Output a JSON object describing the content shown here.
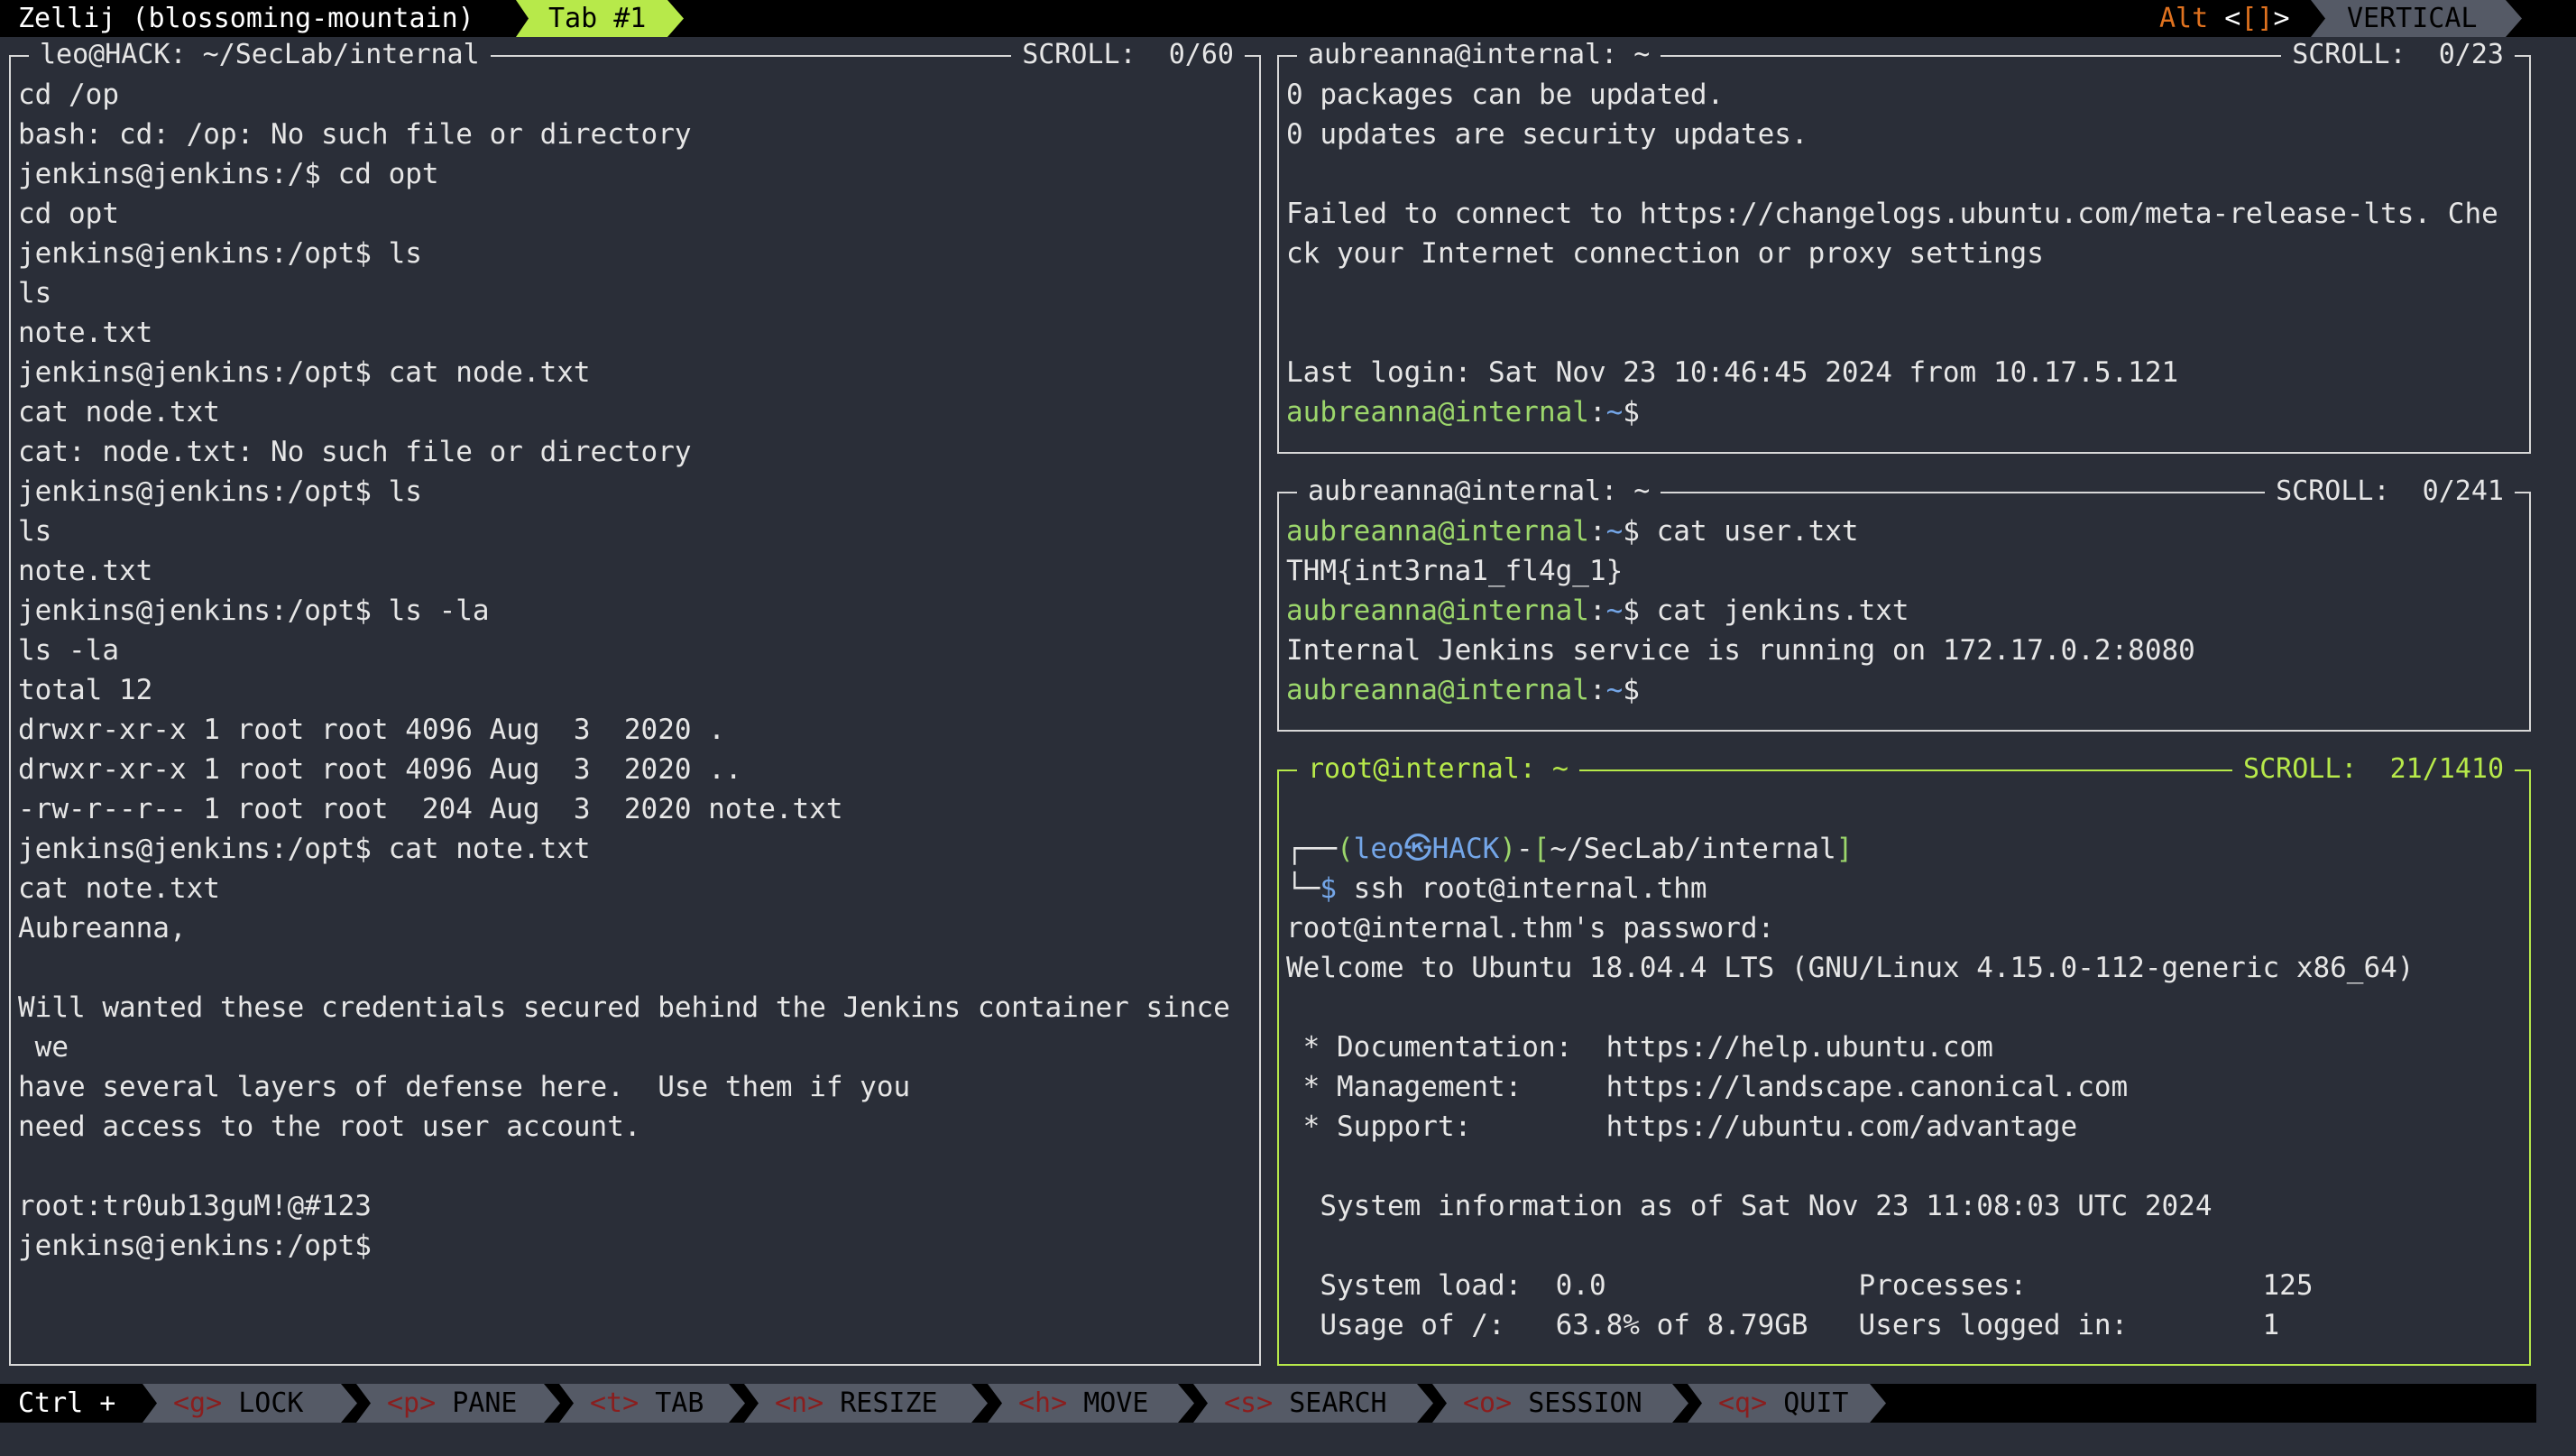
{
  "topbar": {
    "title": "Zellij (blossoming-mountain)",
    "tab_label": "Tab #1",
    "mode_alt_prefix": "Alt ",
    "mode_alt_lt": "<",
    "mode_alt_brackets": "[]",
    "mode_alt_gt": ">",
    "layout_label": "VERTICAL"
  },
  "left_pane": {
    "title": "leo@HACK: ~/SecLab/internal",
    "scroll": "SCROLL:  0/60",
    "lines": [
      "cd /op",
      "bash: cd: /op: No such file or directory",
      "jenkins@jenkins:/$ cd opt",
      "cd opt",
      "jenkins@jenkins:/opt$ ls",
      "ls",
      "note.txt",
      "jenkins@jenkins:/opt$ cat node.txt",
      "cat node.txt",
      "cat: node.txt: No such file or directory",
      "jenkins@jenkins:/opt$ ls",
      "ls",
      "note.txt",
      "jenkins@jenkins:/opt$ ls -la",
      "ls -la",
      "total 12",
      "drwxr-xr-x 1 root root 4096 Aug  3  2020 .",
      "drwxr-xr-x 1 root root 4096 Aug  3  2020 ..",
      "-rw-r--r-- 1 root root  204 Aug  3  2020 note.txt",
      "jenkins@jenkins:/opt$ cat note.txt",
      "cat note.txt",
      "Aubreanna,",
      "",
      "Will wanted these credentials secured behind the Jenkins container since",
      " we",
      "have several layers of defense here.  Use them if you",
      "need access to the root user account.",
      "",
      "root:tr0ub13guM!@#123",
      "jenkins@jenkins:/opt$"
    ]
  },
  "pane_top_right": {
    "title": "aubreanna@internal: ~",
    "scroll": "SCROLL:  0/23",
    "lines": [
      "0 packages can be updated.",
      "0 updates are security updates.",
      "",
      "Failed to connect to https://changelogs.ubuntu.com/meta-release-lts. Che",
      "ck your Internet connection or proxy settings",
      "",
      "",
      "Last login: Sat Nov 23 10:46:45 2024 from 10.17.5.121"
    ],
    "prompt_user": "aubreanna@internal",
    "prompt_colon": ":",
    "prompt_path": "~",
    "prompt_symbol": "$"
  },
  "pane_mid_right": {
    "title": "aubreanna@internal: ~",
    "scroll": "SCROLL:  0/241",
    "prompt_user": "aubreanna@internal",
    "prompt_colon": ":",
    "prompt_path": "~",
    "prompt_symbol": "$",
    "cmd1": " cat user.txt",
    "out1": "THM{int3rna1_fl4g_1}",
    "cmd2": " cat jenkins.txt",
    "out2": "Internal Jenkins service is running on 172.17.0.2:8080"
  },
  "pane_bottom_right": {
    "title": "root@internal: ~",
    "scroll": "SCROLL:  21/1410",
    "kali_corner_top": "┌──",
    "kali_open_paren": "(",
    "kali_user": "leo",
    "kali_symbol": "㉿",
    "kali_host": "HACK",
    "kali_close_paren": ")",
    "kali_dash": "-",
    "kali_open_bracket": "[",
    "kali_path": "~/SecLab/internal",
    "kali_close_bracket": "]",
    "kali_corner_bottom": "└─",
    "kali_dollar": "$",
    "kali_cmd": " ssh root@internal.thm",
    "lines": [
      "root@internal.thm's password:",
      "Welcome to Ubuntu 18.04.4 LTS (GNU/Linux 4.15.0-112-generic x86_64)",
      "",
      " * Documentation:  https://help.ubuntu.com",
      " * Management:     https://landscape.canonical.com",
      " * Support:        https://ubuntu.com/advantage",
      "",
      "  System information as of Sat Nov 23 11:08:03 UTC 2024",
      "",
      "  System load:  0.0               Processes:              125",
      "  Usage of /:   63.8% of 8.79GB   Users logged in:        1"
    ]
  },
  "bottombar": {
    "ctrl_label": "Ctrl +",
    "keys": [
      {
        "key": "<g>",
        "action": " LOCK"
      },
      {
        "key": "<p>",
        "action": " PANE"
      },
      {
        "key": "<t>",
        "action": " TAB"
      },
      {
        "key": "<n>",
        "action": " RESIZE"
      },
      {
        "key": "<h>",
        "action": " MOVE"
      },
      {
        "key": "<s>",
        "action": " SEARCH"
      },
      {
        "key": "<o>",
        "action": " SESSION"
      },
      {
        "key": "<q>",
        "action": " QUIT"
      }
    ]
  },
  "colors": {
    "accent_green": "#b7e94a",
    "prompt_green": "#9cd66b",
    "path_blue": "#74a6e8",
    "mode_orange": "#e0721f",
    "background": "#2a2e38"
  }
}
